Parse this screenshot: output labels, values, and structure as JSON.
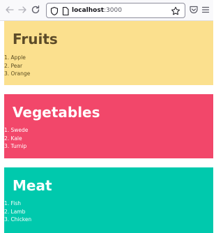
{
  "browser": {
    "url_host": "localhost",
    "url_port": ":3000",
    "back_icon": "arrow-left-icon",
    "forward_icon": "arrow-right-icon",
    "reload_icon": "reload-icon",
    "shield_icon": "shield-icon",
    "page_icon": "page-icon",
    "bookmark_icon": "star-icon",
    "pocket_icon": "pocket-icon",
    "menu_icon": "hamburger-menu-icon"
  },
  "sections": [
    {
      "title": "Fruits",
      "items": [
        "1. Apple",
        "2. Pear",
        "3. Orange"
      ],
      "background": "#fbe08e",
      "text_color": "#5c4b28"
    },
    {
      "title": "Vegetables",
      "items": [
        "1. Swede",
        "2. Kale",
        "3. Turnip"
      ],
      "background": "#f2476a",
      "text_color": "#ffffff"
    },
    {
      "title": "Meat",
      "items": [
        "1. Fish",
        "2. Lamb",
        "3. Chicken"
      ],
      "background": "#00c9ad",
      "text_color": "#ffffff"
    }
  ]
}
